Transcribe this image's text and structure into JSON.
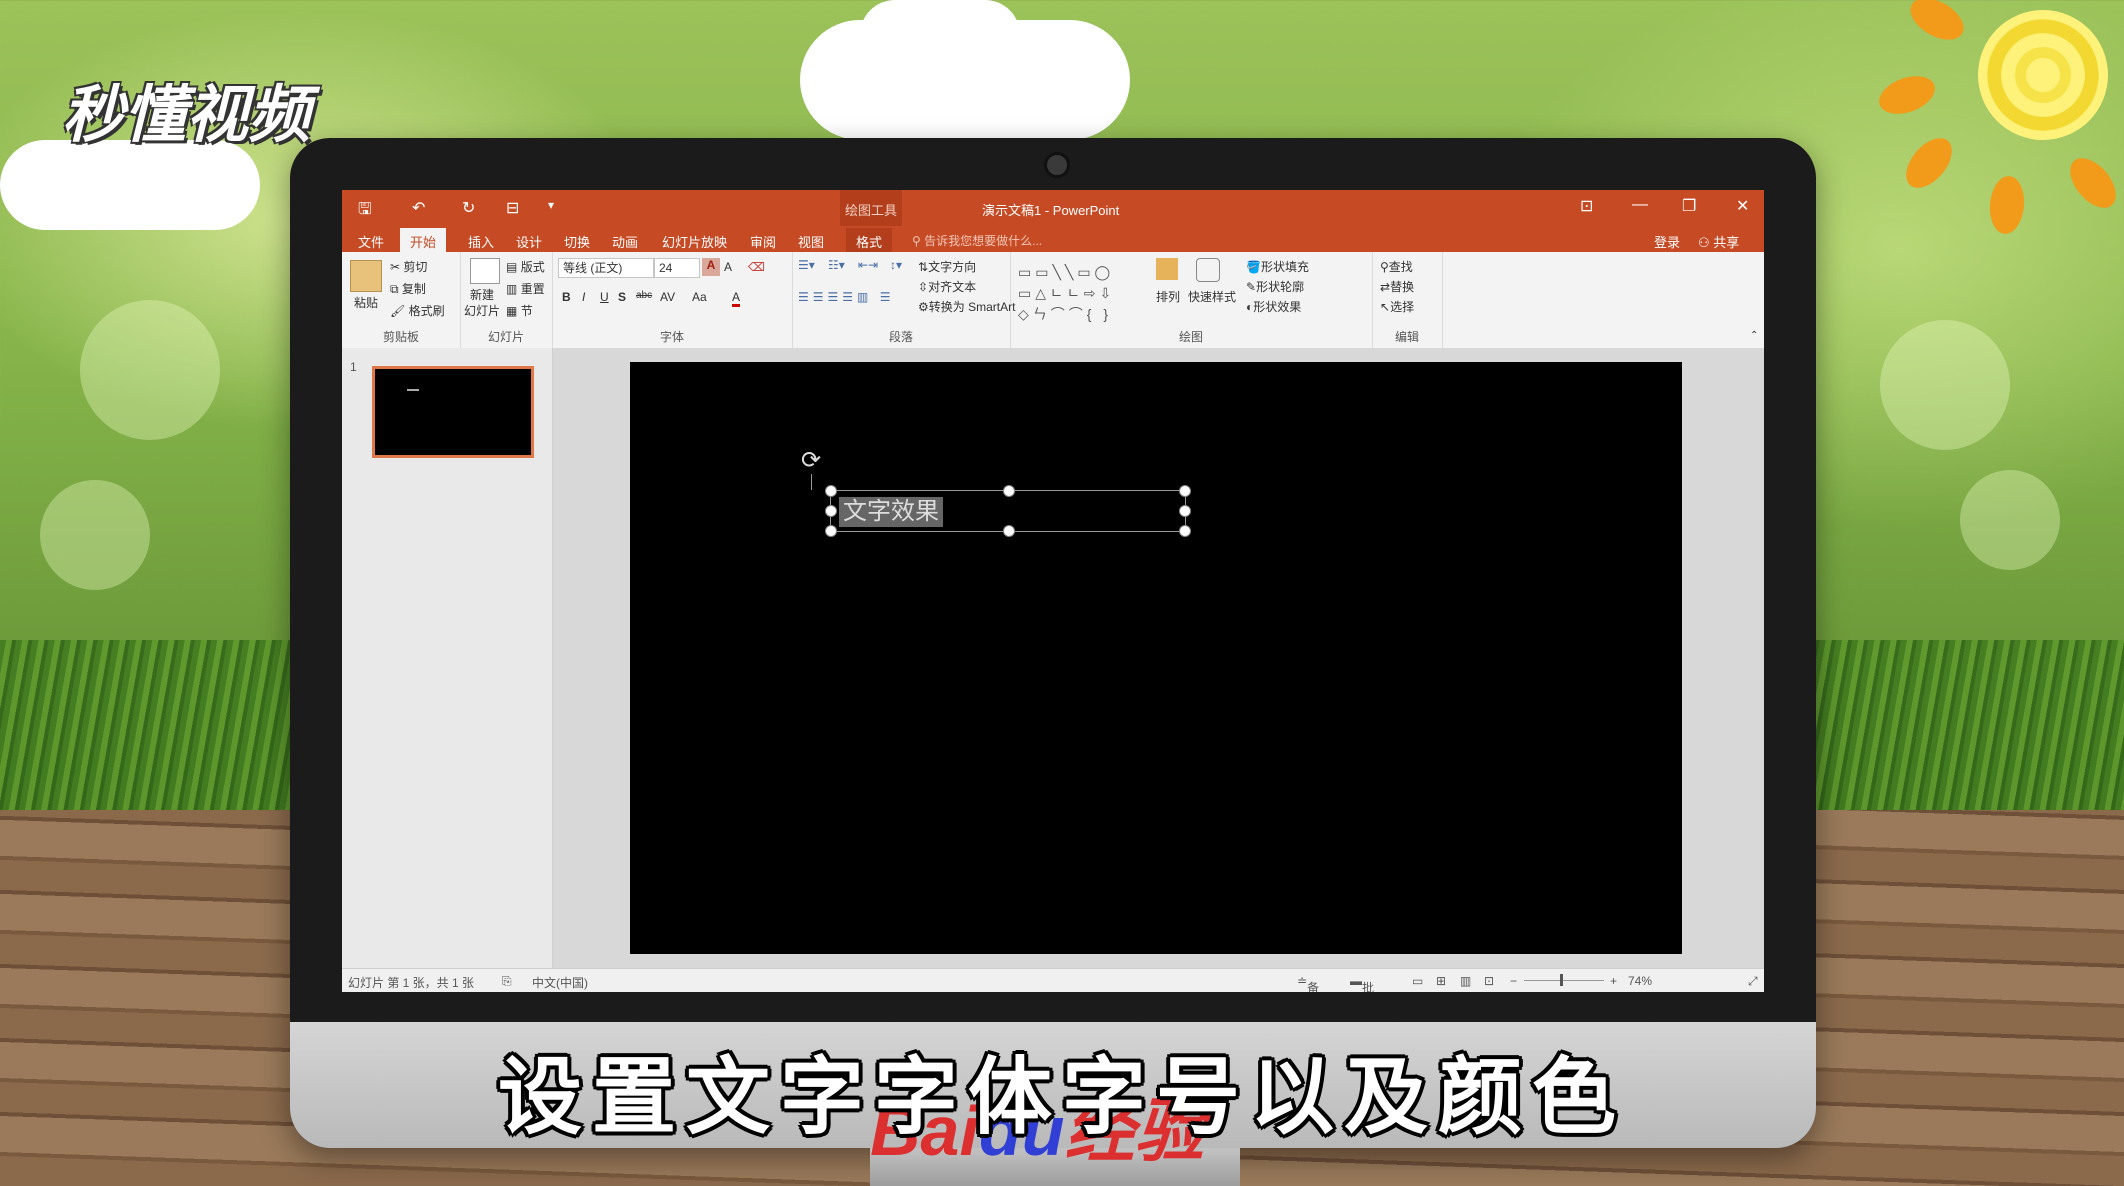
{
  "watermark": {
    "logo": "秒懂视频",
    "baidu_left": "Bai",
    "baidu_du": "du",
    "baidu_right": "经验"
  },
  "subtitle": "设置文字字体字号以及颜色",
  "titlebar": {
    "context_tools": "绘图工具",
    "title": "演示文稿1 - PowerPoint",
    "qa_save": "🖫",
    "qa_undo": "↶",
    "qa_redo": "↻",
    "qa_present": "⊟",
    "qa_more": "▾",
    "restore_ribbon": "⊡",
    "minimize": "—",
    "maximize": "❐",
    "close": "✕"
  },
  "tabs": [
    "文件",
    "开始",
    "插入",
    "设计",
    "切换",
    "动画",
    "幻灯片放映",
    "审阅",
    "视图",
    "格式"
  ],
  "active_tab": "开始",
  "tell_me": "告诉我您想要做什么...",
  "account": {
    "login": "登录",
    "share": "共享"
  },
  "ribbon": {
    "clipboard": {
      "label": "剪贴板",
      "paste": "粘贴",
      "cut": "剪切",
      "copy": "复制",
      "format_painter": "格式刷"
    },
    "slides": {
      "label": "幻灯片",
      "new_slide_1": "新建",
      "new_slide_2": "幻灯片",
      "layout": "版式",
      "reset": "重置",
      "section": "节"
    },
    "font": {
      "label": "字体",
      "font_name": "等线 (正文)",
      "font_size": "24",
      "bold": "B",
      "italic": "I",
      "underline": "U",
      "shadow": "S",
      "strike": "abc",
      "spacing": "AV",
      "case": "Aa",
      "color": "A",
      "grow": "A",
      "shrink": "A"
    },
    "paragraph": {
      "label": "段落",
      "text_direction": "文字方向",
      "align_text": "对齐文本",
      "smartart": "转换为 SmartArt"
    },
    "drawing": {
      "label": "绘图",
      "arrange": "排列",
      "quick_styles": "快速样式",
      "shape_fill": "形状填充",
      "shape_outline": "形状轮廓",
      "shape_effects": "形状效果"
    },
    "editing": {
      "label": "编辑",
      "find": "查找",
      "replace": "替换",
      "select": "选择"
    }
  },
  "thumbnail": {
    "number": "1"
  },
  "slide": {
    "selected_text": "文字效果",
    "rotate": "⟳"
  },
  "statusbar": {
    "slide_info": "幻灯片 第 1 张，共 1 张",
    "language": "中文(中国)",
    "notes": "备注",
    "comments": "批注",
    "zoom_minus": "−",
    "zoom_plus": "+",
    "zoom": "74%"
  }
}
